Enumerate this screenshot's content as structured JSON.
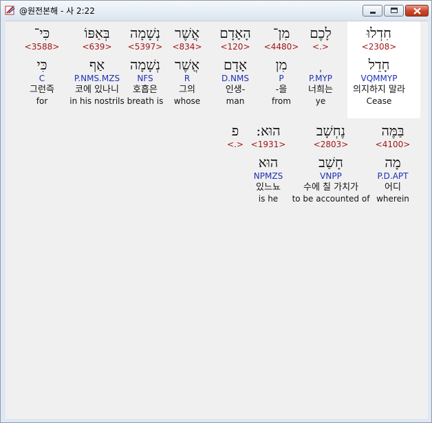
{
  "window": {
    "title": "@원전본해 - 사 2:22"
  },
  "rows": [
    {
      "words": [
        {
          "heb": "חִדְלוּ",
          "strong": "<2308>",
          "lemma": "חָדֵל",
          "morph": "VQMMYP",
          "kor": "의지하지 말라",
          "eng": "Cease",
          "highlighted": true
        },
        {
          "heb": "לָכֶם",
          "strong": "<.>",
          "lemma": "ְ",
          "morph": "P.MYP",
          "kor": "너희는",
          "eng": "ye"
        },
        {
          "heb": "מִן־",
          "strong": "<4480>",
          "lemma": "מִן",
          "morph": "P",
          "kor": "-을",
          "eng": "from"
        },
        {
          "heb": "הָאָדָם",
          "strong": "<120>",
          "lemma": "אָדָם",
          "morph": "D.NMS",
          "kor": "인생-",
          "eng": "man"
        },
        {
          "heb": "אֲשֶׁר",
          "strong": "<834>",
          "lemma": "אֲשֶׁר",
          "morph": "R",
          "kor": "그의",
          "eng": "whose"
        },
        {
          "heb": "נְשָׁמָה",
          "strong": "<5397>",
          "lemma": "נְשָׁמָה",
          "morph": "NFS",
          "kor": "호흡은",
          "eng": "breath is"
        },
        {
          "heb": "בְּאַפּוֹ",
          "strong": "<639>",
          "lemma": "אַף",
          "morph": "P.NMS.MZS",
          "kor": "코에 있나니",
          "eng": "in his nostrils"
        },
        {
          "heb": "כִּי־",
          "strong": "<3588>",
          "lemma": "כִּי",
          "morph": "C",
          "kor": "그런즉",
          "eng": "for"
        }
      ]
    },
    {
      "words": [
        {
          "heb": "בַּמֶּה",
          "strong": "<4100>",
          "lemma": "מָה",
          "morph": "P.D.APT",
          "kor": "어디",
          "eng": "wherein"
        },
        {
          "heb": "נֶחְשָׁב",
          "strong": "<2803>",
          "lemma": "חָשַׁב",
          "morph": "VNPP",
          "kor": "수에 칠 가치가",
          "eng": "to be accounted of"
        },
        {
          "heb": "הוּא:",
          "strong": "<1931>",
          "lemma": "הוּא",
          "morph": "NPMZS",
          "kor": "있느뇨",
          "eng": "is he"
        },
        {
          "heb": "פ",
          "strong": "<.>",
          "lemma": "",
          "morph": "",
          "kor": "",
          "eng": ""
        }
      ]
    }
  ]
}
